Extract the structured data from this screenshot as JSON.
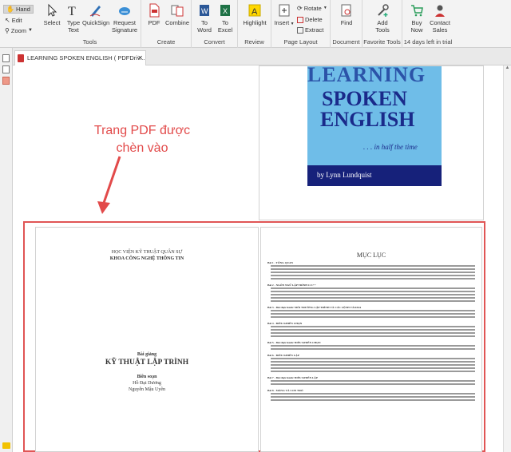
{
  "ribbon": {
    "hand": "Hand",
    "edit": "Edit",
    "zoom": "Zoom",
    "tools": [
      {
        "name": "select-button",
        "label": "Select"
      },
      {
        "name": "type-text-button",
        "label": "Type\nText"
      },
      {
        "name": "quicksign-button",
        "label": "QuickSign"
      },
      {
        "name": "request-signature-button",
        "label": "Request\nSignature"
      },
      {
        "name": "pdf-button",
        "label": "PDF"
      },
      {
        "name": "combine-button",
        "label": "Combine"
      },
      {
        "name": "to-word-button",
        "label": "To\nWord"
      },
      {
        "name": "to-excel-button",
        "label": "To\nExcel"
      },
      {
        "name": "highlight-button",
        "label": "Highlight"
      },
      {
        "name": "insert-button",
        "label": "Insert"
      },
      {
        "name": "find-button",
        "label": "Find"
      },
      {
        "name": "add-tools-button",
        "label": "Add\nTools"
      },
      {
        "name": "buy-now-button",
        "label": "Buy\nNow"
      },
      {
        "name": "contact-sales-button",
        "label": "Contact\nSales"
      }
    ],
    "rotate": "Rotate",
    "delete": "Delete",
    "extract": "Extract",
    "groups": {
      "tools": "Tools",
      "create": "Create",
      "convert": "Convert",
      "review": "Review",
      "page_layout": "Page Layout",
      "document": "Document",
      "favorite_tools": "Favorite Tools",
      "trial": "14 days left in trial"
    }
  },
  "tab": {
    "title": "LEARNING SPOKEN ENGLISH ( PDFDriv..."
  },
  "cover": {
    "line1": "LEARNING",
    "line2": "SPOKEN",
    "line3": "ENGLISH",
    "tagline": ". . . in half the time",
    "author": "by Lynn Lundquist"
  },
  "annotation": {
    "line1": "Trang PDF được",
    "line2": "chèn vào"
  },
  "left_page": {
    "school": "HỌC VIỆN KỸ THUẬT QUÂN SỰ",
    "faculty": "KHOA CÔNG NGHỆ THÔNG TIN",
    "subtitle": "Bài giảng",
    "title": "KỸ THUẬT LẬP TRÌNH",
    "compiled": "Biên soạn",
    "author1": "Hồ Đại Dương",
    "author2": "Nguyễn Mậu Uyên"
  },
  "right_page": {
    "title": "MỤC LỤC",
    "headings": [
      "Bài 1 - TỔNG QUAN",
      "Bài 2 - NGÔN NGỮ LẬP TRÌNH C/C++",
      "Bài 3 - Bài thực hành: MÔI TRƯỜNG LẬP TRÌNH VÀ CÁC LỆNH VÀO/RA",
      "Bài 4 - ĐIỀU KHIỂN CHỌN",
      "Bài 5 - Bài thực hành: ĐIỀU KHIỂN CHỌN",
      "Bài 6 - ĐIỀU KHIỂN LẶP",
      "Bài 7 - Bài thực hành: ĐIỀU KHIỂN LẶP",
      "Bài 8 - MẢNG VÀ CON TRỎ"
    ]
  }
}
